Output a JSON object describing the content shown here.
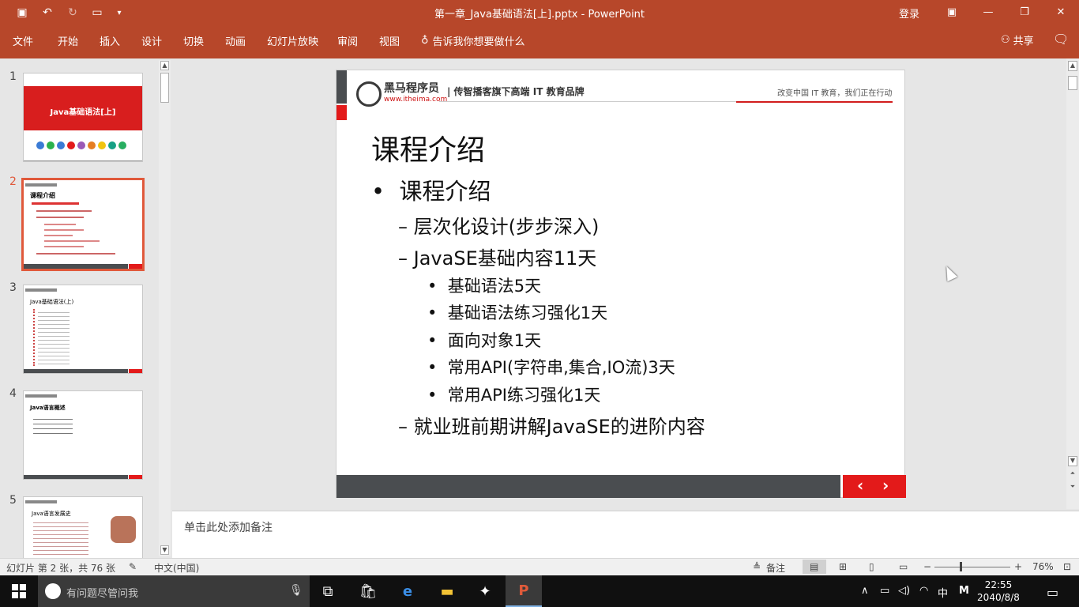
{
  "titlebar": {
    "title": "第一章_Java基础语法[上].pptx  -  PowerPoint",
    "login": "登录",
    "colors": {
      "accent": "#b7472a"
    }
  },
  "ribbon": {
    "tabs": [
      "文件",
      "开始",
      "插入",
      "设计",
      "切换",
      "动画",
      "幻灯片放映",
      "审阅",
      "视图"
    ],
    "tell_me": "告诉我你想要做什么",
    "share": "共享"
  },
  "thumbnails": [
    {
      "number": "1",
      "title": "Java基础语法[上]"
    },
    {
      "number": "2",
      "title": "课程介绍"
    },
    {
      "number": "3",
      "title": "Java基础语法(上)"
    },
    {
      "number": "4",
      "title": "Java语言概述"
    },
    {
      "number": "5",
      "title": "Java语言发展史"
    }
  ],
  "slide": {
    "brand": "黑马程序员",
    "url": "www.itheima.com",
    "tagline": "| 传智播客旗下高端 IT 教育品牌",
    "slogan": "改变中国 IT 教育，我们正在行动",
    "title": "课程介绍",
    "bullet1": "课程介绍",
    "sub1": "层次化设计(步步深入)",
    "sub2": "JavaSE基础内容11天",
    "items": [
      "基础语法5天",
      "基础语法练习强化1天",
      "面向对象1天",
      "常用API(字符串,集合,IO流)3天",
      "常用API练习强化1天"
    ],
    "sub3": "就业班前期讲解JavaSE的进阶内容",
    "nav_prev": "‹",
    "nav_next": "›",
    "colors": {
      "red": "#e31a1a",
      "dark": "#4a4d50"
    }
  },
  "notes": {
    "placeholder": "单击此处添加备注"
  },
  "status": {
    "slide_info": "幻灯片 第 2 张，共 76 张",
    "language": "中文(中国)",
    "notes_btn": "备注",
    "zoom": "76%"
  },
  "taskbar": {
    "search_placeholder": "有问题尽管问我",
    "ime": "中",
    "ime2": "M",
    "time": "22:55",
    "date": "2040/8/8"
  }
}
